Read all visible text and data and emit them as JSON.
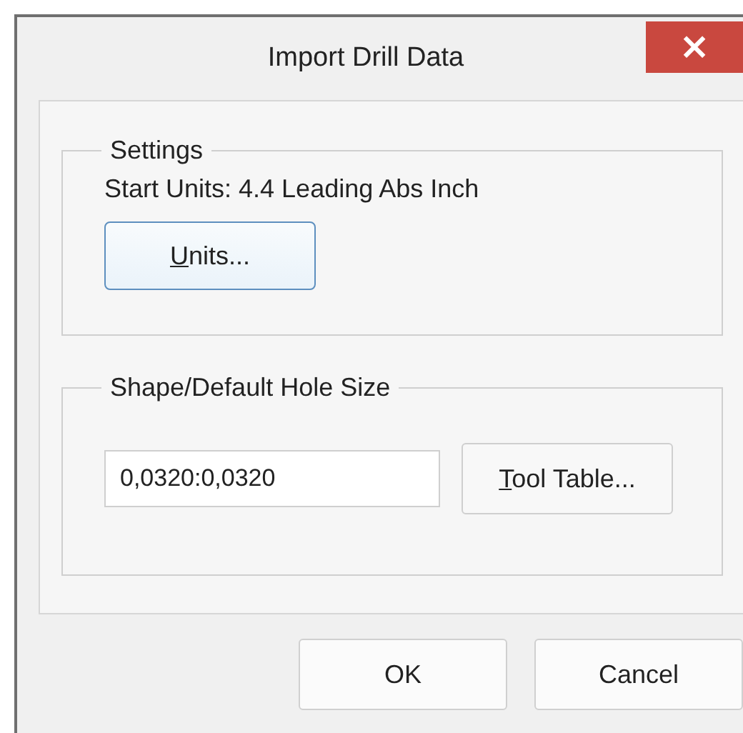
{
  "window": {
    "title": "Import Drill Data",
    "close": "×"
  },
  "settings": {
    "legend": "Settings",
    "start_units": "Start Units: 4.4 Leading Abs Inch",
    "button": {
      "label": "Units...",
      "mnemonic_first": true
    }
  },
  "hole_size": {
    "legend": "Shape/Default Hole Size",
    "value": "0,0320:0,0320",
    "button": {
      "label": "Tool Table...",
      "mnemonic_first": true
    }
  },
  "buttons": [
    "OK",
    "Cancel"
  ]
}
